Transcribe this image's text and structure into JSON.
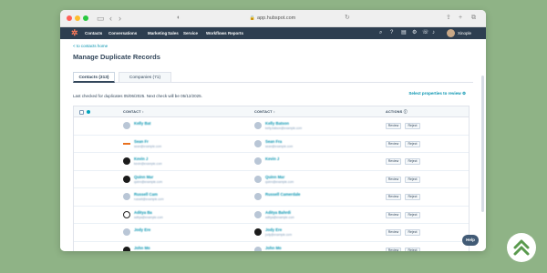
{
  "browser": {
    "url": "app.hubspot.com",
    "nav_back": "‹",
    "nav_forward": "›"
  },
  "navbar": {
    "items": [
      "Contacts",
      "Conversations",
      "Marketing",
      "Sales",
      "Service",
      "Workflows",
      "Reports"
    ],
    "account": "Xinople"
  },
  "page": {
    "back_link": "< to contacts home",
    "title": "Manage Duplicate Records",
    "tabs": [
      "Contacts (313)",
      "Companies (71)"
    ],
    "last_checked": "Last checked for duplicates 05/06/2025. Next check will be 05/12/2025.",
    "select_properties": "Select properties to review",
    "columns": [
      "CONTACT",
      "CONTACT",
      "ACTIONS"
    ]
  },
  "rows": [
    {
      "left_name": "Kelly Bat",
      "left_sub": "",
      "right_name": "Kelly Batson",
      "right_sub": "kelly.batson@example.com",
      "left_logo": "avatar",
      "right_logo": "avatar"
    },
    {
      "left_name": "Sean Fr",
      "left_sub": "sean@example.com",
      "right_name": "Sean Fra",
      "right_sub": "sean@example.com",
      "left_logo": "orange",
      "right_logo": "avatar"
    },
    {
      "left_name": "Kevin J",
      "left_sub": "kevin@example.com",
      "right_name": "Kevin J",
      "right_sub": "",
      "left_logo": "dark",
      "right_logo": "avatar"
    },
    {
      "left_name": "Quinn Mar",
      "left_sub": "quinn@example.com",
      "right_name": "Quinn Mar",
      "right_sub": "quinn@example.com",
      "left_logo": "dark",
      "right_logo": "avatar"
    },
    {
      "left_name": "Russell Cam",
      "left_sub": "russell@example.com",
      "right_name": "Russell Camerdale",
      "right_sub": "",
      "left_logo": "avatar",
      "right_logo": "avatar"
    },
    {
      "left_name": "Aditya Ba",
      "left_sub": "aditya@example.com",
      "right_name": "Aditya Bahrdi",
      "right_sub": "aditya@example.com",
      "left_logo": "outline",
      "right_logo": "avatar"
    },
    {
      "left_name": "Jody Ere",
      "left_sub": "",
      "right_name": "Jody Ere",
      "right_sub": "jody@example.com",
      "left_logo": "avatar",
      "right_logo": "dark"
    },
    {
      "left_name": "John Mo",
      "left_sub": "john.mo@example.com",
      "right_name": "John Mo",
      "right_sub": "",
      "left_logo": "dark",
      "right_logo": "avatar"
    }
  ],
  "actions": {
    "review": "Review",
    "reject": "Reject"
  },
  "help": "Help",
  "colors": {
    "nav": "#2d3e50",
    "accent": "#0091ae",
    "background": "#8fb386",
    "logo": "#ff7a59"
  }
}
